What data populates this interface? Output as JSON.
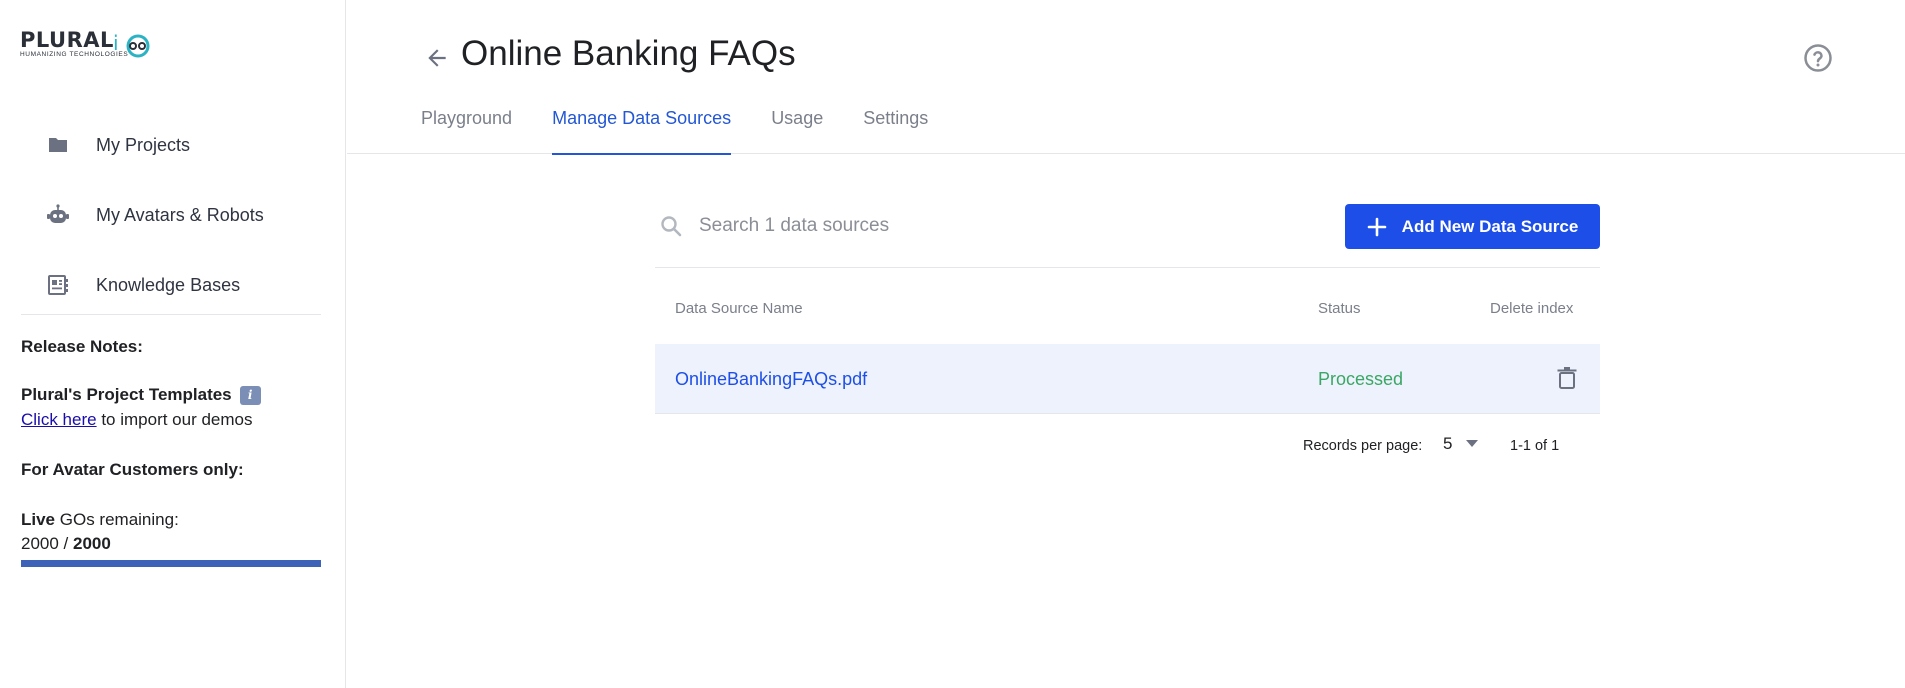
{
  "brand": {
    "name": "PLURAL",
    "suffix": "i",
    "tagline": "HUMANIZING TECHNOLOGIES"
  },
  "sidebar": {
    "items": [
      {
        "label": "My Projects",
        "icon": "folder-icon"
      },
      {
        "label": "My Avatars & Robots",
        "icon": "robot-icon"
      },
      {
        "label": "Knowledge Bases",
        "icon": "knowledge-base-icon"
      }
    ],
    "release_notes": {
      "title": "Release Notes:",
      "templates_title": "Plural's Project Templates",
      "info_badge": "i",
      "click_here": "Click here",
      "import_text": " to import our demos",
      "avatar_only": "For Avatar Customers only:",
      "live_label": "Live",
      "gos_remaining": " GOs remaining:",
      "used": "2000",
      "separator": " / ",
      "total": "2000",
      "progress_fraction": 1.0
    }
  },
  "header": {
    "title": "Online Banking FAQs",
    "tabs": [
      {
        "label": "Playground",
        "active": false
      },
      {
        "label": "Manage Data Sources",
        "active": true
      },
      {
        "label": "Usage",
        "active": false
      },
      {
        "label": "Settings",
        "active": false
      }
    ]
  },
  "main": {
    "search": {
      "placeholder": "Search 1 data sources",
      "value": ""
    },
    "add_button": "Add New Data Source",
    "table": {
      "columns": [
        "Data Source Name",
        "Status",
        "Delete index"
      ],
      "rows": [
        {
          "name": "OnlineBankingFAQs.pdf",
          "status": "Processed"
        }
      ]
    },
    "pagination": {
      "records_label": "Records per page:",
      "records_value": "5",
      "range": "1-1 of 1"
    }
  },
  "colors": {
    "accent": "#1d4fe8",
    "status_processed": "#3aa765",
    "row_highlight": "#eef2fc",
    "progress": "#3d63b8"
  }
}
